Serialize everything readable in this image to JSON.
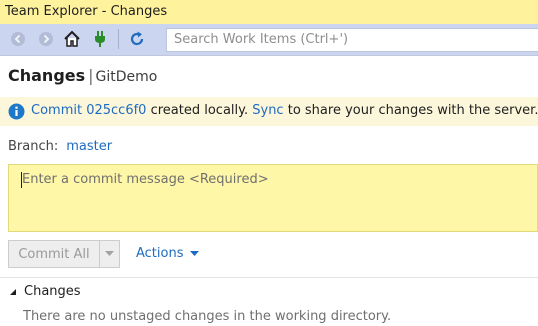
{
  "window": {
    "title": "Team Explorer - Changes"
  },
  "toolbar": {
    "back_icon": "back-arrow-icon",
    "forward_icon": "forward-arrow-icon",
    "home_icon": "home-icon",
    "connect_icon": "plug-icon",
    "refresh_icon": "refresh-icon",
    "search_placeholder": "Search Work Items (Ctrl+')"
  },
  "header": {
    "title": "Changes",
    "separator": "|",
    "repo": "GitDemo"
  },
  "notification": {
    "icon": "info-icon",
    "prefix": "Commit",
    "commit_id": "025cc6f0",
    "middle": " created locally. ",
    "sync_link": "Sync",
    "suffix": " to share your changes with the server."
  },
  "branch": {
    "label": "Branch:",
    "value": "master"
  },
  "commit_message": {
    "placeholder": "Enter a commit message <Required>"
  },
  "actions_bar": {
    "commit_label": "Commit All",
    "actions_label": "Actions"
  },
  "changes_section": {
    "title": "Changes",
    "empty_message": "There are no unstaged changes in the working directory."
  },
  "colors": {
    "title_bar": "#fff29d",
    "toolbar": "#ccd5f0",
    "info_bar": "#fcf7db",
    "commit_box": "#fff7a8",
    "link": "#1e6bc0"
  }
}
